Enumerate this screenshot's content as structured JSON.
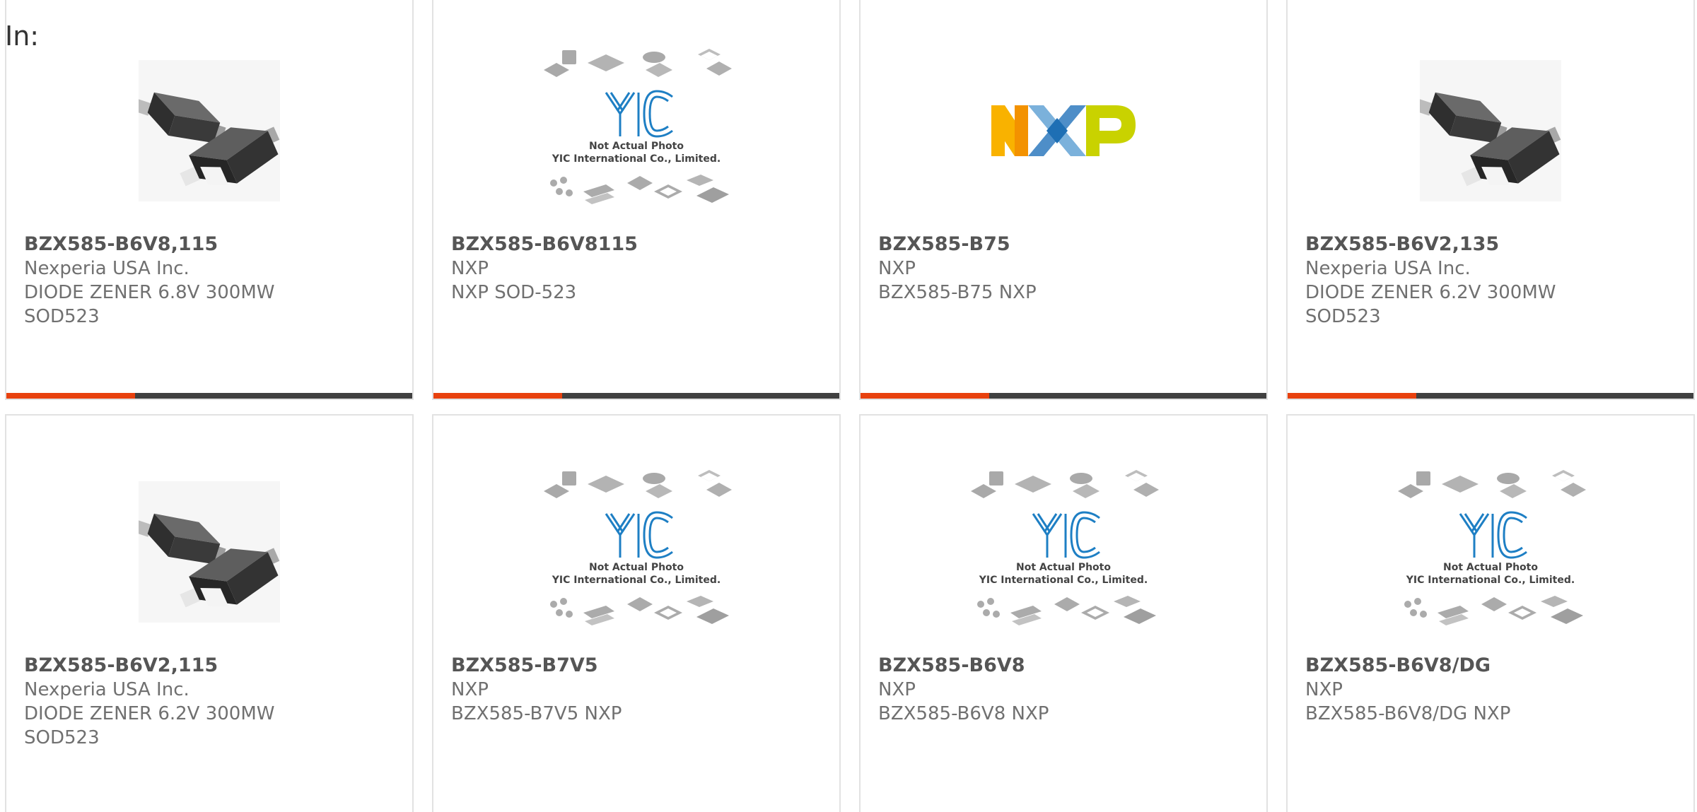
{
  "header": {
    "label": "In:"
  },
  "products": [
    {
      "part_number": "BZX585-B6V8,115",
      "manufacturer": "Nexperia USA Inc.",
      "desc1": "DIODE ZENER 6.8V 300MW",
      "desc2": "SOD523",
      "image": "diode-package-photo"
    },
    {
      "part_number": "BZX585-B6V8115",
      "manufacturer": "NXP",
      "desc1": "NXP SOD-523",
      "desc2": "",
      "image": "not-actual-photo",
      "placeholder_line1": "Not Actual Photo",
      "placeholder_line2": "YIC International Co., Limited."
    },
    {
      "part_number": "BZX585-B75",
      "manufacturer": "NXP",
      "desc1": "BZX585-B75 NXP",
      "desc2": "",
      "image": "nxp-logo",
      "logo_text": "NXP"
    },
    {
      "part_number": "BZX585-B6V2,135",
      "manufacturer": "Nexperia USA Inc.",
      "desc1": "DIODE ZENER 6.2V 300MW",
      "desc2": "SOD523",
      "image": "diode-package-photo"
    },
    {
      "part_number": "BZX585-B6V2,115",
      "manufacturer": "Nexperia USA Inc.",
      "desc1": "DIODE ZENER 6.2V 300MW",
      "desc2": "SOD523",
      "image": "diode-package-photo"
    },
    {
      "part_number": "BZX585-B7V5",
      "manufacturer": "NXP",
      "desc1": "BZX585-B7V5 NXP",
      "desc2": "",
      "image": "not-actual-photo",
      "placeholder_line1": "Not Actual Photo",
      "placeholder_line2": "YIC International Co., Limited."
    },
    {
      "part_number": "BZX585-B6V8",
      "manufacturer": "NXP",
      "desc1": "BZX585-B6V8 NXP",
      "desc2": "",
      "image": "not-actual-photo",
      "placeholder_line1": "Not Actual Photo",
      "placeholder_line2": "YIC International Co., Limited."
    },
    {
      "part_number": "BZX585-B6V8/DG",
      "manufacturer": "NXP",
      "desc1": "BZX585-B6V8/DG NXP",
      "desc2": "",
      "image": "not-actual-photo",
      "placeholder_line1": "Not Actual Photo",
      "placeholder_line2": "YIC International Co., Limited."
    }
  ],
  "colors": {
    "accent": "#e8410e",
    "bar": "#404040",
    "text": "#707070",
    "part_number": "#555555",
    "yic_blue": "#1e7fc4"
  }
}
